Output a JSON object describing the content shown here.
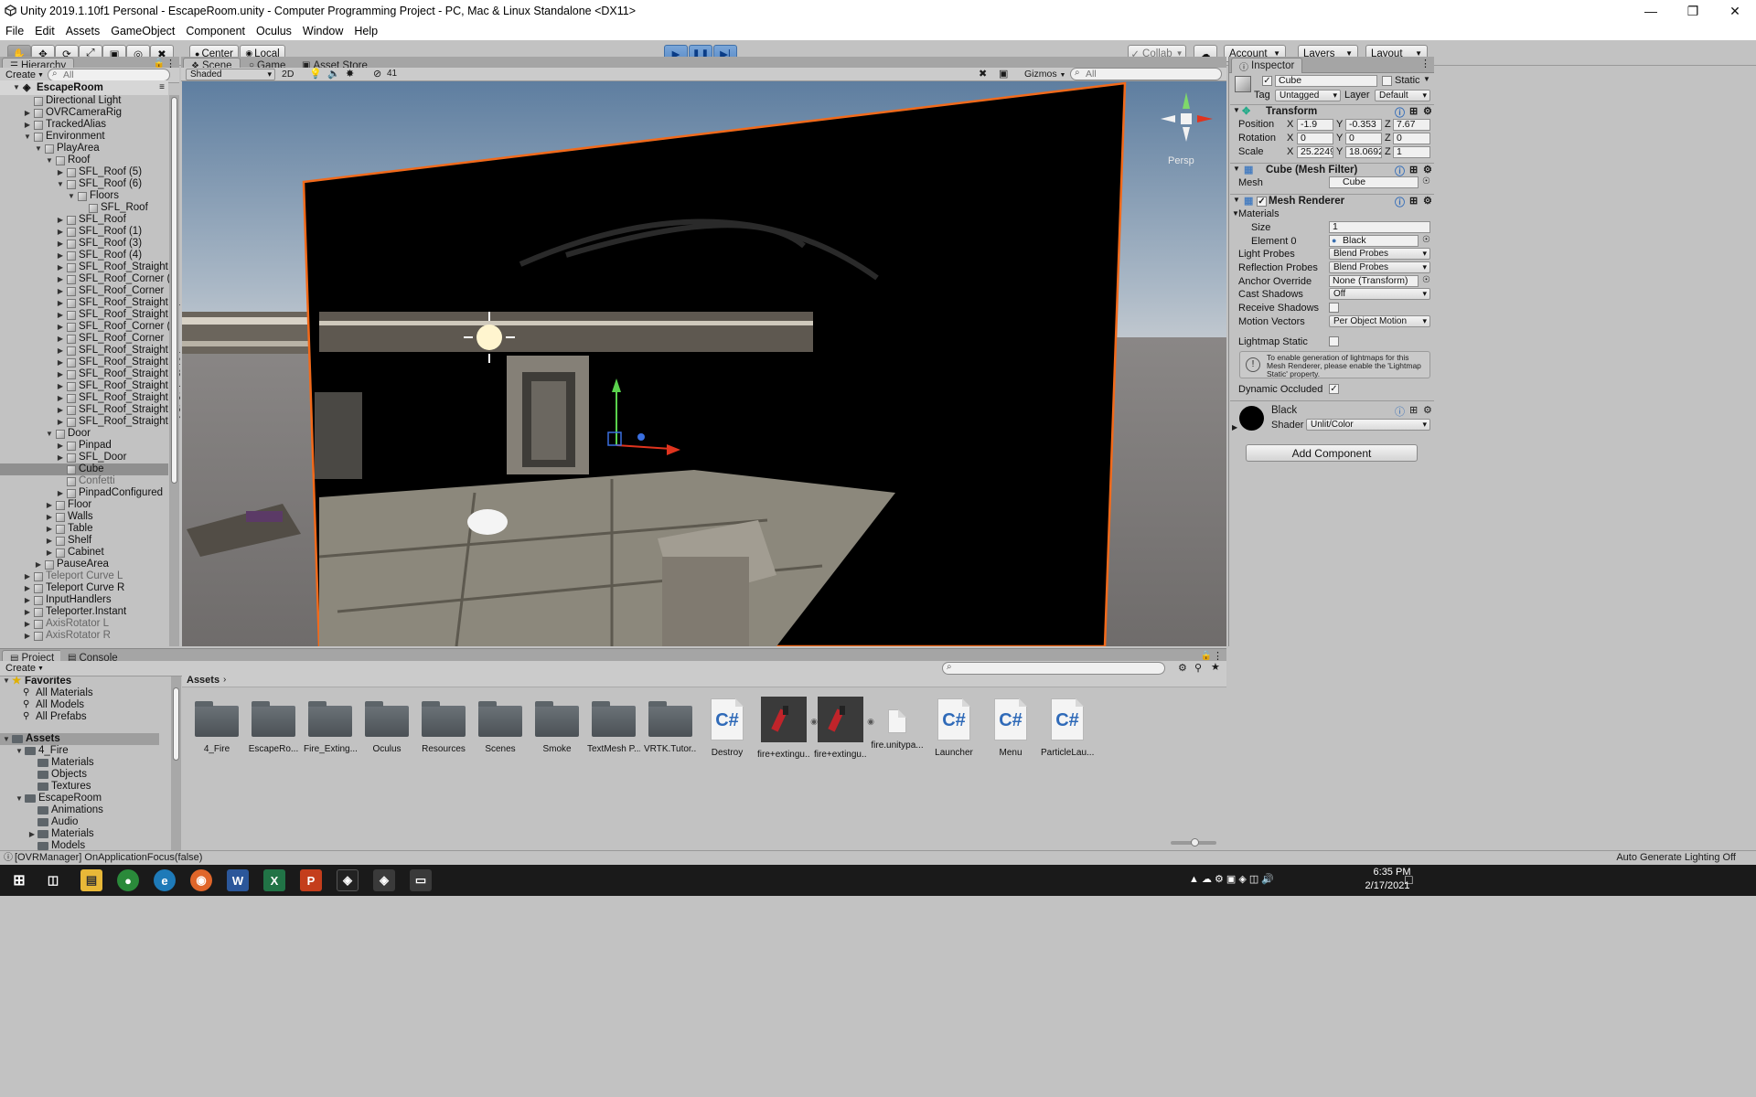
{
  "window": {
    "title": "Unity 2019.1.10f1 Personal - EscapeRoom.unity - Computer Programming Project - PC, Mac & Linux Standalone <DX11>"
  },
  "menu": [
    "File",
    "Edit",
    "Assets",
    "GameObject",
    "Component",
    "Oculus",
    "Window",
    "Help"
  ],
  "toolbar": {
    "center": "Center",
    "local": "Local",
    "collab": "Collab",
    "account": "Account",
    "layers": "Layers",
    "layout": "Layout"
  },
  "hierarchy": {
    "tab": "Hierarchy",
    "create": "Create",
    "search_placeholder": "All",
    "scene": "EscapeRoom",
    "items": [
      {
        "label": "Directional Light",
        "depth": 1,
        "arrow": ""
      },
      {
        "label": "OVRCameraRig",
        "depth": 1,
        "arrow": "r"
      },
      {
        "label": "TrackedAlias",
        "depth": 1,
        "arrow": "r"
      },
      {
        "label": "Environment",
        "depth": 1,
        "arrow": "d"
      },
      {
        "label": "PlayArea",
        "depth": 2,
        "arrow": "d"
      },
      {
        "label": "Roof",
        "depth": 3,
        "arrow": "d"
      },
      {
        "label": "SFL_Roof (5)",
        "depth": 4,
        "arrow": "r"
      },
      {
        "label": "SFL_Roof (6)",
        "depth": 4,
        "arrow": "d"
      },
      {
        "label": "Floors",
        "depth": 5,
        "arrow": "d"
      },
      {
        "label": "SFL_Roof",
        "depth": 6,
        "arrow": ""
      },
      {
        "label": "SFL_Roof",
        "depth": 4,
        "arrow": "r"
      },
      {
        "label": "SFL_Roof (1)",
        "depth": 4,
        "arrow": "r"
      },
      {
        "label": "SFL_Roof (3)",
        "depth": 4,
        "arrow": "r"
      },
      {
        "label": "SFL_Roof (4)",
        "depth": 4,
        "arrow": "r"
      },
      {
        "label": "SFL_Roof_Straight",
        "depth": 4,
        "arrow": "r"
      },
      {
        "label": "SFL_Roof_Corner (1)",
        "depth": 4,
        "arrow": "r"
      },
      {
        "label": "SFL_Roof_Corner",
        "depth": 4,
        "arrow": "r"
      },
      {
        "label": "SFL_Roof_Straight (1",
        "depth": 4,
        "arrow": "r"
      },
      {
        "label": "SFL_Roof_Straight",
        "depth": 4,
        "arrow": "r"
      },
      {
        "label": "SFL_Roof_Corner (1)",
        "depth": 4,
        "arrow": "r"
      },
      {
        "label": "SFL_Roof_Corner",
        "depth": 4,
        "arrow": "r"
      },
      {
        "label": "SFL_Roof_Straight (1",
        "depth": 4,
        "arrow": "r"
      },
      {
        "label": "SFL_Roof_Straight (2",
        "depth": 4,
        "arrow": "r"
      },
      {
        "label": "SFL_Roof_Straight (3",
        "depth": 4,
        "arrow": "r"
      },
      {
        "label": "SFL_Roof_Straight (4",
        "depth": 4,
        "arrow": "r"
      },
      {
        "label": "SFL_Roof_Straight (5",
        "depth": 4,
        "arrow": "r"
      },
      {
        "label": "SFL_Roof_Straight (6",
        "depth": 4,
        "arrow": "r"
      },
      {
        "label": "SFL_Roof_Straight (7",
        "depth": 4,
        "arrow": "r"
      },
      {
        "label": "Door",
        "depth": 3,
        "arrow": "d"
      },
      {
        "label": "Pinpad",
        "depth": 4,
        "arrow": "r"
      },
      {
        "label": "SFL_Door",
        "depth": 4,
        "arrow": "r"
      },
      {
        "label": "Cube",
        "depth": 4,
        "arrow": "",
        "selected": true
      },
      {
        "label": "Confetti",
        "depth": 4,
        "arrow": "",
        "dim": true
      },
      {
        "label": "PinpadConfigured",
        "depth": 4,
        "arrow": "r"
      },
      {
        "label": "Floor",
        "depth": 3,
        "arrow": "r"
      },
      {
        "label": "Walls",
        "depth": 3,
        "arrow": "r"
      },
      {
        "label": "Table",
        "depth": 3,
        "arrow": "r"
      },
      {
        "label": "Shelf",
        "depth": 3,
        "arrow": "r"
      },
      {
        "label": "Cabinet",
        "depth": 3,
        "arrow": "r"
      },
      {
        "label": "PauseArea",
        "depth": 2,
        "arrow": "r"
      },
      {
        "label": "Teleport Curve L",
        "depth": 1,
        "arrow": "r",
        "dim": true
      },
      {
        "label": "Teleport Curve R",
        "depth": 1,
        "arrow": "r"
      },
      {
        "label": "InputHandlers",
        "depth": 1,
        "arrow": "r"
      },
      {
        "label": "Teleporter.Instant",
        "depth": 1,
        "arrow": "r"
      },
      {
        "label": "AxisRotator L",
        "depth": 1,
        "arrow": "r",
        "dim": true
      },
      {
        "label": "AxisRotator R",
        "depth": 1,
        "arrow": "r",
        "dim": true
      }
    ]
  },
  "scene": {
    "tabs": [
      "Scene",
      "Game",
      "Asset Store"
    ],
    "shading": "Shaded",
    "mode2d": "2D",
    "fx_count": "41",
    "gizmos": "Gizmos",
    "search_placeholder": "All",
    "persp": "Persp"
  },
  "inspector": {
    "tab": "Inspector",
    "object_name": "Cube",
    "static_label": "Static",
    "tag_label": "Tag",
    "tag_value": "Untagged",
    "layer_label": "Layer",
    "layer_value": "Default",
    "transform": {
      "title": "Transform",
      "position_label": "Position",
      "rotation_label": "Rotation",
      "scale_label": "Scale",
      "position": [
        "-1.9",
        "-0.353",
        "7.67"
      ],
      "rotation": [
        "0",
        "0",
        "0"
      ],
      "scale": [
        "25.2249",
        "18.0692",
        "1"
      ]
    },
    "mesh_filter": {
      "title": "Cube (Mesh Filter)",
      "mesh_label": "Mesh",
      "mesh_value": "Cube"
    },
    "mesh_renderer": {
      "title": "Mesh Renderer",
      "materials": "Materials",
      "size_label": "Size",
      "size_value": "1",
      "element0_label": "Element 0",
      "element0_value": "Black",
      "light_probes_label": "Light Probes",
      "light_probes": "Blend Probes",
      "reflection_probes_label": "Reflection Probes",
      "reflection_probes": "Blend Probes",
      "anchor_label": "Anchor Override",
      "anchor_value": "None (Transform)",
      "cast_shadows_label": "Cast Shadows",
      "cast_shadows": "Off",
      "receive_shadows_label": "Receive Shadows",
      "motion_vectors_label": "Motion Vectors",
      "motion_vectors": "Per Object Motion",
      "lightmap_static_label": "Lightmap Static",
      "info": "To enable generation of lightmaps for this Mesh Renderer, please enable the 'Lightmap Static' property.",
      "dynamic_occluded_label": "Dynamic Occluded"
    },
    "material": {
      "name": "Black",
      "shader_label": "Shader",
      "shader_value": "Unlit/Color"
    },
    "add_component": "Add Component"
  },
  "project": {
    "tabs": [
      "Project",
      "Console"
    ],
    "create": "Create",
    "favorites": {
      "label": "Favorites",
      "items": [
        "All Materials",
        "All Models",
        "All Prefabs"
      ]
    },
    "tree": [
      {
        "label": "Assets",
        "depth": 0,
        "arrow": "d",
        "header": true
      },
      {
        "label": "4_Fire",
        "depth": 1,
        "arrow": "d"
      },
      {
        "label": "Materials",
        "depth": 2,
        "arrow": ""
      },
      {
        "label": "Objects",
        "depth": 2,
        "arrow": ""
      },
      {
        "label": "Textures",
        "depth": 2,
        "arrow": ""
      },
      {
        "label": "EscapeRoom",
        "depth": 1,
        "arrow": "d"
      },
      {
        "label": "Animations",
        "depth": 2,
        "arrow": ""
      },
      {
        "label": "Audio",
        "depth": 2,
        "arrow": ""
      },
      {
        "label": "Materials",
        "depth": 2,
        "arrow": "r"
      },
      {
        "label": "Models",
        "depth": 2,
        "arrow": ""
      }
    ],
    "breadcrumb": "Assets",
    "assets": [
      {
        "name": "4_Fire",
        "kind": "folder"
      },
      {
        "name": "EscapeRo...",
        "kind": "folder"
      },
      {
        "name": "Fire_Exting...",
        "kind": "folder"
      },
      {
        "name": "Oculus",
        "kind": "folder"
      },
      {
        "name": "Resources",
        "kind": "folder"
      },
      {
        "name": "Scenes",
        "kind": "folder"
      },
      {
        "name": "Smoke",
        "kind": "folder"
      },
      {
        "name": "TextMesh P...",
        "kind": "folder"
      },
      {
        "name": "VRTK.Tutor...",
        "kind": "folder"
      },
      {
        "name": "Destroy",
        "kind": "script"
      },
      {
        "name": "fire+extingu...",
        "kind": "prefab"
      },
      {
        "name": "fire+extingu...",
        "kind": "prefab"
      },
      {
        "name": "fire.unitypa...",
        "kind": "package"
      },
      {
        "name": "Launcher",
        "kind": "script"
      },
      {
        "name": "Menu",
        "kind": "script"
      },
      {
        "name": "ParticleLau...",
        "kind": "script"
      }
    ]
  },
  "status": {
    "message": "[OVRManager] OnApplicationFocus(false)",
    "right": "Auto Generate Lighting Off"
  },
  "taskbar": {
    "time": "6:35 PM",
    "date": "2/17/2021"
  },
  "colors": {
    "selection_outline": "#f26a1b",
    "scene_sky": "#8aa4be",
    "editor_bg": "#c2c2c2"
  }
}
